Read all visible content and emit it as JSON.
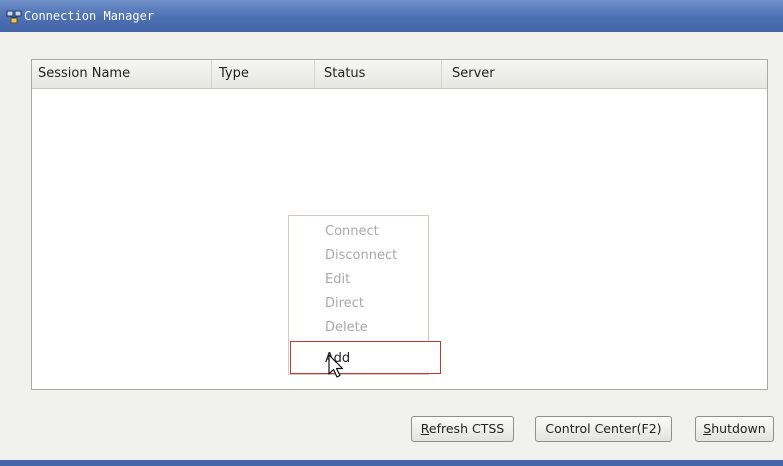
{
  "window": {
    "title": "Connection Manager",
    "icon": "connection-manager-icon"
  },
  "session_list": {
    "columns": [
      "Session Name",
      "Type",
      "Status",
      "Server"
    ],
    "rows": []
  },
  "context_menu": {
    "items": [
      {
        "label": "Connect",
        "enabled": false
      },
      {
        "label": "Disconnect",
        "enabled": false
      },
      {
        "label": "Edit",
        "enabled": false
      },
      {
        "label": "Direct",
        "enabled": false
      },
      {
        "label": "Delete",
        "enabled": false
      }
    ],
    "highlighted_item": {
      "label": "Add",
      "enabled": true
    }
  },
  "buttons": {
    "refresh": {
      "mnemonic": "R",
      "rest": "efresh CTSS"
    },
    "control_center": {
      "label": "Control Center(F2)"
    },
    "shutdown": {
      "mnemonic": "S",
      "rest": "hutdown"
    }
  },
  "colors": {
    "titlebar": "#4d70b3",
    "highlight_border": "#c0392b",
    "disabled_text": "#a9a9a9"
  }
}
